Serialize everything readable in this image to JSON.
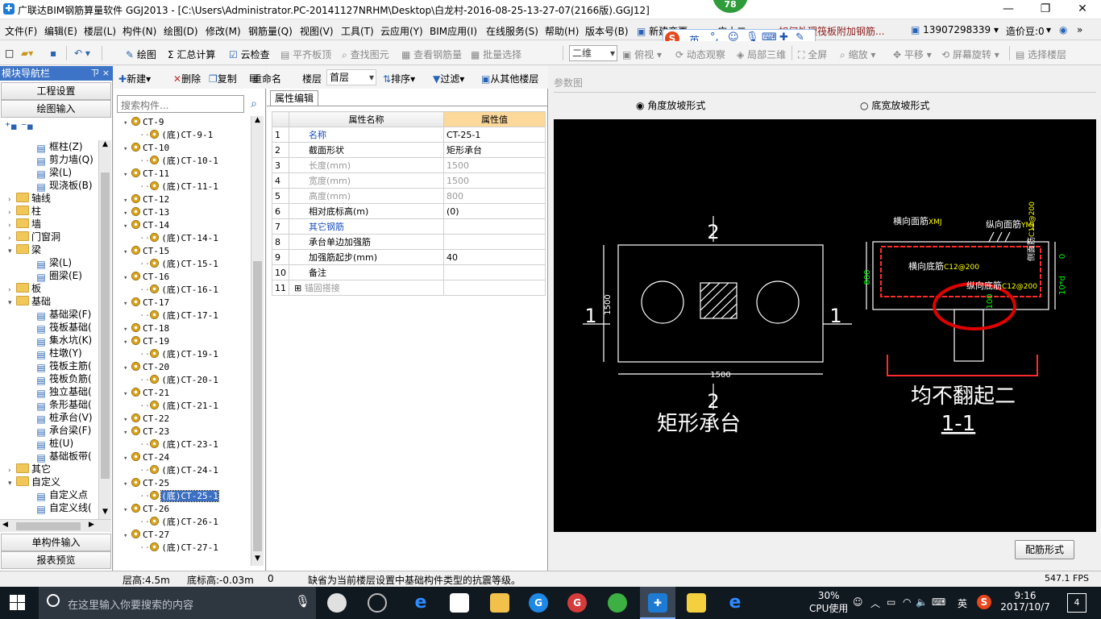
{
  "window": {
    "title": "广联达BIM钢筋算量软件 GGJ2013 - [C:\\Users\\Administrator.PC-20141127NRHM\\Desktop\\白龙村-2016-08-25-13-27-07(2166版).GGJ12]",
    "badge": "78"
  },
  "menu": {
    "items": [
      "文件(F)",
      "编辑(E)",
      "楼层(L)",
      "构件(N)",
      "绘图(D)",
      "修改(M)",
      "钢筋量(Q)",
      "视图(V)",
      "工具(T)",
      "云应用(Y)",
      "BIM应用(I)",
      "在线服务(S)",
      "帮助(H)",
      "版本号(B)",
      "新建变更",
      "广小二"
    ],
    "question": "如何处理筏板附加钢筋...",
    "phone": "13907298339",
    "price": "造价豆:0"
  },
  "ime": {
    "label": "英"
  },
  "toolbar": {
    "draw": "绘图",
    "sum": "汇总计算",
    "cloud_check": "云检查",
    "level_top": "平齐板顶",
    "find_elem": "查找图元",
    "view_rebar": "查看钢筋量",
    "batch_select": "批量选择",
    "view_mode": "二维",
    "top_view": "俯视",
    "dyn_view": "动态观察",
    "local_3d": "局部三维",
    "fullscreen": "全屏",
    "zoom": "缩放",
    "pan": "平移",
    "rotate": "屏幕旋转",
    "select_floor": "选择楼层"
  },
  "nav": {
    "title": "模块导航栏",
    "pin": "ㄗ ×",
    "btn_project": "工程设置",
    "btn_draw": "绘图输入",
    "btn_single": "单构件输入",
    "btn_report": "报表预览",
    "tree": [
      {
        "label": "框柱(Z)",
        "level": 2,
        "type": "comp"
      },
      {
        "label": "剪力墙(Q)",
        "level": 2,
        "type": "comp"
      },
      {
        "label": "梁(L)",
        "level": 2,
        "type": "comp"
      },
      {
        "label": "现浇板(B)",
        "level": 2,
        "type": "comp"
      },
      {
        "label": "轴线",
        "level": 1,
        "type": "folder",
        "exp": "+"
      },
      {
        "label": "柱",
        "level": 1,
        "type": "folder",
        "exp": "+"
      },
      {
        "label": "墙",
        "level": 1,
        "type": "folder",
        "exp": "+"
      },
      {
        "label": "门窗洞",
        "level": 1,
        "type": "folder",
        "exp": "+"
      },
      {
        "label": "梁",
        "level": 1,
        "type": "folder",
        "exp": "-"
      },
      {
        "label": "梁(L)",
        "level": 2,
        "type": "comp"
      },
      {
        "label": "圈梁(E)",
        "level": 2,
        "type": "comp"
      },
      {
        "label": "板",
        "level": 1,
        "type": "folder",
        "exp": "+"
      },
      {
        "label": "基础",
        "level": 1,
        "type": "folder",
        "exp": "-"
      },
      {
        "label": "基础梁(F)",
        "level": 2,
        "type": "comp"
      },
      {
        "label": "筏板基础(",
        "level": 2,
        "type": "comp"
      },
      {
        "label": "集水坑(K)",
        "level": 2,
        "type": "comp"
      },
      {
        "label": "柱墩(Y)",
        "level": 2,
        "type": "comp"
      },
      {
        "label": "筏板主筋(",
        "level": 2,
        "type": "comp"
      },
      {
        "label": "筏板负筋(",
        "level": 2,
        "type": "comp"
      },
      {
        "label": "独立基础(",
        "level": 2,
        "type": "comp"
      },
      {
        "label": "条形基础(",
        "level": 2,
        "type": "comp"
      },
      {
        "label": "桩承台(V)",
        "level": 2,
        "type": "comp"
      },
      {
        "label": "承台梁(F)",
        "level": 2,
        "type": "comp"
      },
      {
        "label": "桩(U)",
        "level": 2,
        "type": "comp"
      },
      {
        "label": "基础板带(",
        "level": 2,
        "type": "comp"
      },
      {
        "label": "其它",
        "level": 1,
        "type": "folder",
        "exp": "+"
      },
      {
        "label": "自定义",
        "level": 1,
        "type": "folder",
        "exp": "-"
      },
      {
        "label": "自定义点",
        "level": 2,
        "type": "comp"
      },
      {
        "label": "自定义线(",
        "level": 2,
        "type": "comp"
      }
    ]
  },
  "comp": {
    "btn_new": "新建",
    "btn_delete": "删除",
    "btn_copy": "复制",
    "btn_rename": "重命名",
    "floor_label": "楼层",
    "floor_value": "首层",
    "sort": "排序",
    "filter": "过滤",
    "copy_from": "从其他楼层",
    "search_placeholder": "搜索构件...",
    "items": [
      {
        "label": "CT-9",
        "sub": false
      },
      {
        "label": "(底)CT-9-1",
        "sub": true
      },
      {
        "label": "CT-10",
        "sub": false
      },
      {
        "label": "(底)CT-10-1",
        "sub": true
      },
      {
        "label": "CT-11",
        "sub": false
      },
      {
        "label": "(底)CT-11-1",
        "sub": true
      },
      {
        "label": "CT-12",
        "sub": false
      },
      {
        "label": "CT-13",
        "sub": false
      },
      {
        "label": "CT-14",
        "sub": false
      },
      {
        "label": "(底)CT-14-1",
        "sub": true
      },
      {
        "label": "CT-15",
        "sub": false
      },
      {
        "label": "(底)CT-15-1",
        "sub": true
      },
      {
        "label": "CT-16",
        "sub": false
      },
      {
        "label": "(底)CT-16-1",
        "sub": true
      },
      {
        "label": "CT-17",
        "sub": false
      },
      {
        "label": "(底)CT-17-1",
        "sub": true
      },
      {
        "label": "CT-18",
        "sub": false
      },
      {
        "label": "CT-19",
        "sub": false
      },
      {
        "label": "(底)CT-19-1",
        "sub": true
      },
      {
        "label": "CT-20",
        "sub": false
      },
      {
        "label": "(底)CT-20-1",
        "sub": true
      },
      {
        "label": "CT-21",
        "sub": false
      },
      {
        "label": "(底)CT-21-1",
        "sub": true
      },
      {
        "label": "CT-22",
        "sub": false
      },
      {
        "label": "CT-23",
        "sub": false
      },
      {
        "label": "(底)CT-23-1",
        "sub": true
      },
      {
        "label": "CT-24",
        "sub": false
      },
      {
        "label": "(底)CT-24-1",
        "sub": true
      },
      {
        "label": "CT-25",
        "sub": false
      },
      {
        "label": "(底)CT-25-1",
        "sub": true,
        "selected": true
      },
      {
        "label": "CT-26",
        "sub": false
      },
      {
        "label": "(底)CT-26-1",
        "sub": true
      },
      {
        "label": "CT-27",
        "sub": false
      },
      {
        "label": "(底)CT-27-1",
        "sub": true
      }
    ]
  },
  "prop": {
    "tab": "属性编辑",
    "col_name": "属性名称",
    "col_value": "属性值",
    "rows": [
      {
        "no": "1",
        "name": "名称",
        "value": "CT-25-1",
        "style": "blue"
      },
      {
        "no": "2",
        "name": "截面形状",
        "value": "矩形承台",
        "style": ""
      },
      {
        "no": "3",
        "name": "长度(mm)",
        "value": "1500",
        "style": "gray"
      },
      {
        "no": "4",
        "name": "宽度(mm)",
        "value": "1500",
        "style": "gray"
      },
      {
        "no": "5",
        "name": "高度(mm)",
        "value": "800",
        "style": "gray"
      },
      {
        "no": "6",
        "name": "相对底标高(m)",
        "value": "(0)",
        "style": ""
      },
      {
        "no": "7",
        "name": "其它钢筋",
        "value": "",
        "style": "blue"
      },
      {
        "no": "8",
        "name": "承台单边加强筋",
        "value": "",
        "style": ""
      },
      {
        "no": "9",
        "name": "加强筋起步(mm)",
        "value": "40",
        "style": ""
      },
      {
        "no": "10",
        "name": "备注",
        "value": "",
        "style": ""
      },
      {
        "no": "11",
        "name": "锚固搭接",
        "value": "",
        "style": "gray",
        "expander": "+"
      }
    ]
  },
  "param": {
    "header": "参数图",
    "radio1": "角度放坡形式",
    "radio2": "底宽放坡形式",
    "button": "配筋形式",
    "drawing": {
      "section_label_top": "2",
      "section_label_bottom": "2",
      "section_label_left": "1",
      "section_label_right": "1",
      "dim_width": "1500",
      "dim_height": "1500",
      "plan_caption": "矩形承台",
      "label_h_top": "横向面筋",
      "label_h_top_code": "XMJ",
      "label_v_top": "纵向面筋",
      "label_v_top_code": "YMJ",
      "label_h_bot": "横向底筋",
      "label_h_bot_code": "C12@200",
      "label_v_bot": "纵向底筋",
      "label_v_bot_code": "C12@200",
      "label_side": "侧面筋",
      "label_side_code": "C12@200",
      "dim_800": "800",
      "dim_0": "0",
      "dim_10d": "10*d",
      "dim_100": "100",
      "section_caption": "均不翻起二",
      "section_name": "1-1"
    }
  },
  "status": {
    "floor_height": "层高:4.5m",
    "bottom_elev": "底标高:-0.03m",
    "count": "0",
    "message": "缺省为当前楼层设置中基础构件类型的抗震等级。",
    "fps": "547.1 FPS"
  },
  "taskbar": {
    "search_placeholder": "在这里输入你要搜索的内容",
    "cpu_percent": "30%",
    "cpu_label": "CPU使用",
    "ime": "英",
    "time": "9:16",
    "date": "2017/10/7",
    "notif_count": "4"
  }
}
